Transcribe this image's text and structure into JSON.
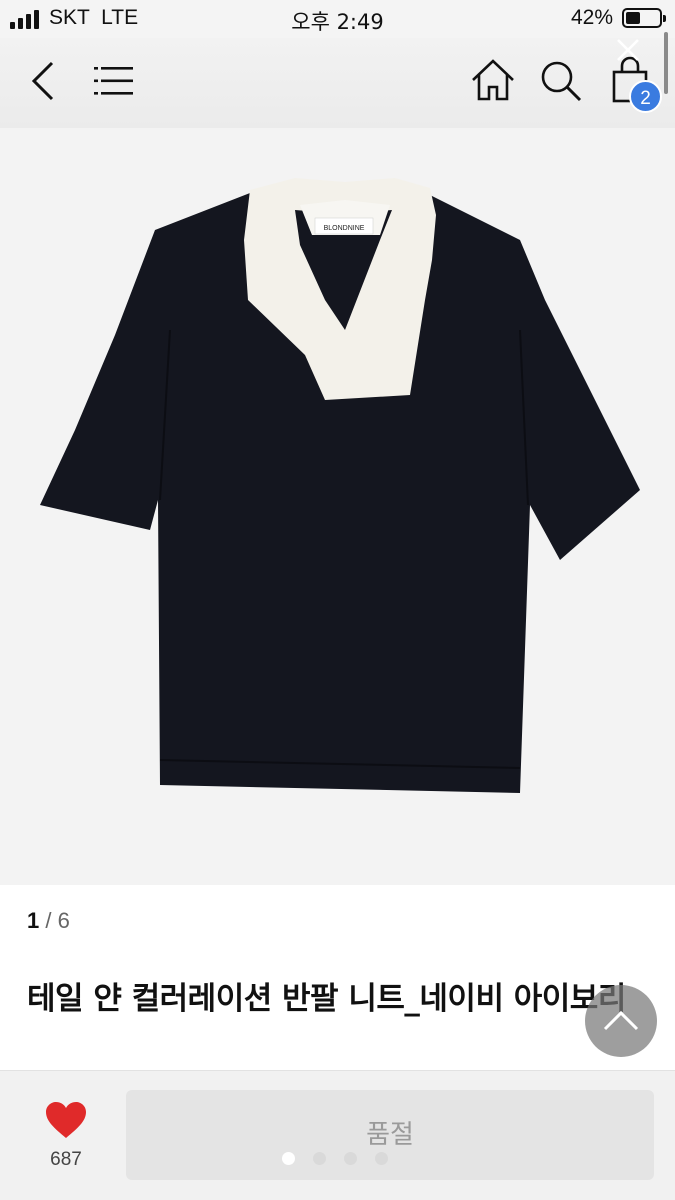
{
  "status_bar": {
    "carrier": "SKT  LTE",
    "time": "오후 2:49",
    "battery": "42%",
    "battery_level": 0.42
  },
  "nav": {
    "icons": [
      "back-icon",
      "menu-icon",
      "home-icon",
      "search-icon",
      "cart-icon",
      "close-icon"
    ],
    "cart_count": "2"
  },
  "product": {
    "brand_label": "BLONDNINE",
    "image_counter": {
      "current": "1",
      "separator": " / ",
      "total": "6"
    },
    "title": "테일 얀 컬러레이션 반팔 니트_네이비 아이보리",
    "colors": {
      "body": "#14161f",
      "collar": "#f3f1ea"
    }
  },
  "bottom_bar": {
    "like_count": "687",
    "soldout_label": "품절",
    "page_dots": {
      "count": 4,
      "active": 0
    },
    "heart_color": "#e02a2a"
  }
}
